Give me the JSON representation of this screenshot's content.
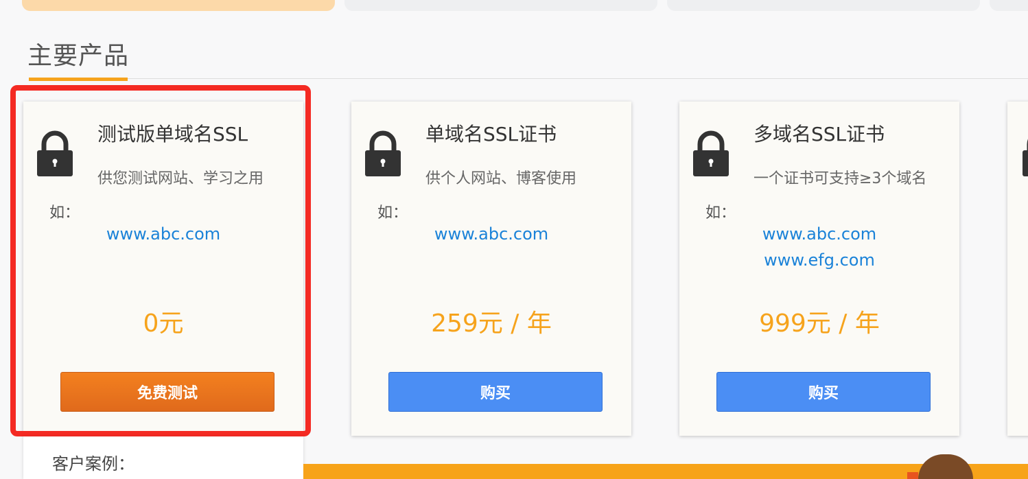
{
  "section": {
    "title": "主要产品"
  },
  "cards": [
    {
      "title": "测试版单域名SSL",
      "desc": "供您测试网站、学习之用",
      "example_label": "如：",
      "domains": [
        "www.abc.com"
      ],
      "price": "0元",
      "button": "免费测试"
    },
    {
      "title": "单域名SSL证书",
      "desc": "供个人网站、博客使用",
      "example_label": "如：",
      "domains": [
        "www.abc.com"
      ],
      "price": "259元 / 年",
      "button": "购买"
    },
    {
      "title": "多域名SSL证书",
      "desc": "一个证书可支持≥3个域名",
      "example_label": "如：",
      "domains": [
        "www.abc.com",
        "www.efg.com"
      ],
      "price": "999元 / 年",
      "button": "购买"
    }
  ],
  "case": {
    "label": "客户案例："
  },
  "colors": {
    "accent": "#f6a31c",
    "link": "#1a82d8",
    "buy_button": "#4b8ef4",
    "trial_button": "#f3801f",
    "highlight": "#f42a23"
  },
  "icons": {
    "card": "lock-icon"
  }
}
